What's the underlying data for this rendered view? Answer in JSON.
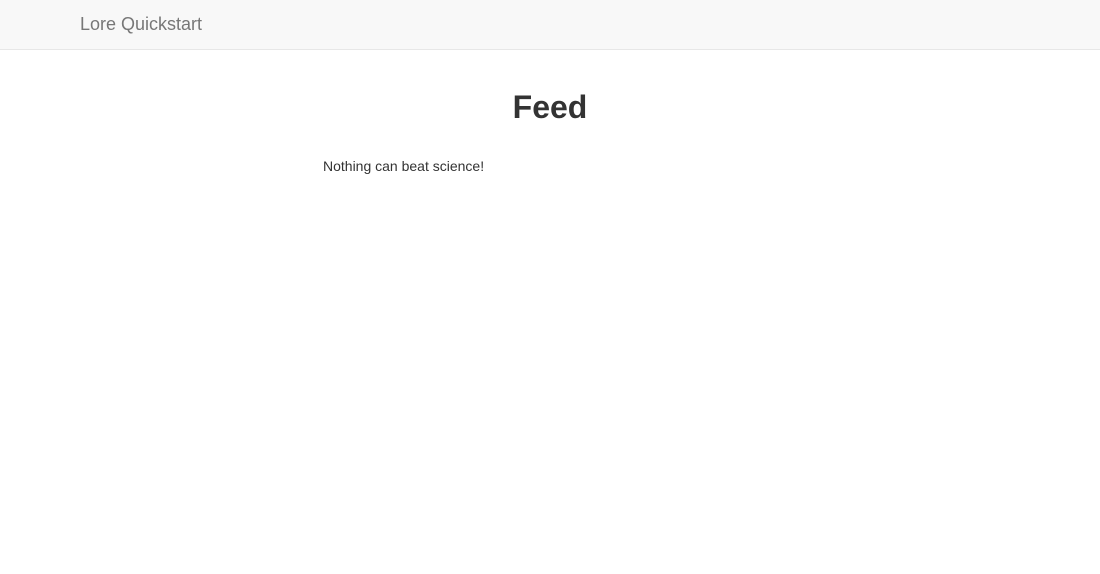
{
  "navbar": {
    "brand": "Lore Quickstart"
  },
  "main": {
    "title": "Feed",
    "tweets": [
      {
        "text": "Nothing can beat science!"
      }
    ]
  },
  "colors": {
    "navbar_bg": "#f8f8f8",
    "navbar_border": "#e7e7e7",
    "brand_text": "#777777",
    "body_text": "#333333"
  }
}
